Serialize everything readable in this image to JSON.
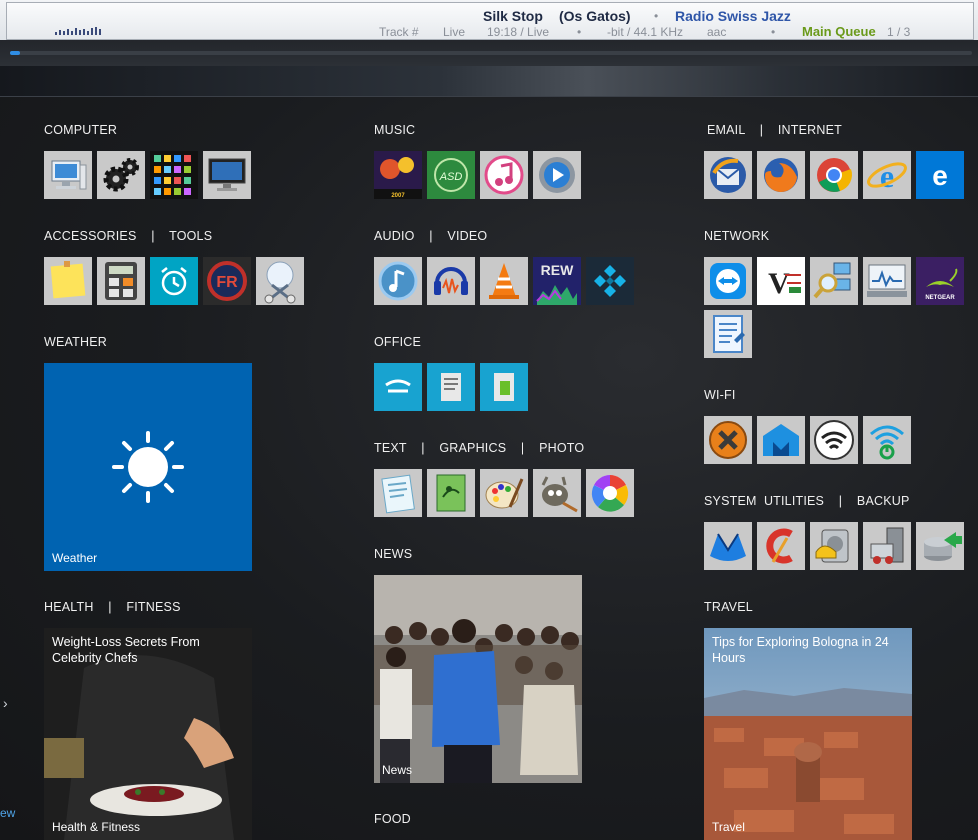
{
  "player": {
    "track_title": "Silk Stop",
    "artist": "(Os Gatos)",
    "separator": "•",
    "station": "Radio Swiss Jazz",
    "track_label": "Track #",
    "live": "Live",
    "time": "19:18 / Live",
    "format": "-bit / 44.1 KHz",
    "codec": "aac",
    "queue_label": "Main Queue",
    "queue_pos": "1 / 3",
    "progress": 0.01
  },
  "sections": {
    "computer": "COMPUTER",
    "music": "MUSIC",
    "email_internet": "EMAIL    |    INTERNET",
    "accessories_tools": "ACCESSORIES    |    TOOLS",
    "audio_video": "AUDIO    |    VIDEO",
    "network": "NETWORK",
    "weather": "WEATHER",
    "office": "OFFICE",
    "wifi": "WI-FI",
    "text_graphics_photo": "TEXT    |    GRAPHICS    |    PHOTO",
    "system_backup": "SYSTEM  UTILITIES    |    BACKUP",
    "news": "NEWS",
    "health_fitness": "HEALTH    |    FITNESS",
    "travel": "TRAVEL",
    "food": "FOOD"
  },
  "tiles": {
    "weather_label": "Weather",
    "health_caption": "Weight-Loss Secrets From Celebrity Chefs",
    "health_label": "Health & Fitness",
    "news_label": "News",
    "travel_caption": "Tips for Exploring Bologna in 24 Hours",
    "travel_label": "Travel"
  },
  "edge": {
    "arrow": "›",
    "text": "ew"
  },
  "colors": {
    "accent": "#0063b1",
    "tile_gray": "#c9c9c9",
    "queue": "#6a9a1a",
    "station": "#2f56a8"
  },
  "icons": {
    "computer": [
      "computer-icon",
      "settings-gears-icon",
      "iphone-apps-icon",
      "monitor-icon"
    ],
    "music": [
      "band-in-a-box-icon",
      "asd-icon",
      "itunes-icon",
      "quicktime-icon"
    ],
    "email_internet": [
      "thunderbird-icon",
      "firefox-icon",
      "chrome-icon",
      "internet-explorer-icon",
      "edge-icon"
    ],
    "accessories_tools": [
      "sticky-notes-icon",
      "calculator-icon",
      "alarms-icon",
      "fastrawviewer-icon",
      "snipping-tool-icon"
    ],
    "audio_video": [
      "audio-player-icon",
      "audacity-icon",
      "vlc-icon",
      "rew-icon",
      "kodi-icon"
    ],
    "network": [
      "teamviewer-icon",
      "vnc-icon",
      "network-scanner-icon",
      "network-monitor-icon",
      "netgear-genie-icon",
      "network-notes-icon"
    ],
    "office": [
      "office-writer-icon",
      "office-document-icon",
      "office-spreadsheet-icon"
    ],
    "wifi": [
      "xirrus-wifi-icon",
      "wifi-inspector-icon",
      "wifi-analyzer-icon",
      "wifi-power-icon"
    ],
    "text_graphics_photo": [
      "notepad-icon",
      "graphics-editor-icon",
      "paint-icon",
      "gimp-icon",
      "picasa-icon"
    ],
    "system_backup": [
      "malwarebytes-icon",
      "ccleaner-icon",
      "disk-utility-icon",
      "system-restore-icon",
      "backup-icon"
    ]
  }
}
